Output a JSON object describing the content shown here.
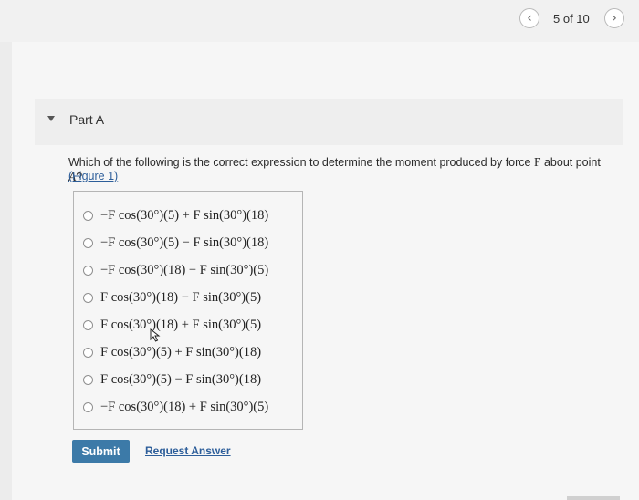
{
  "pagination": {
    "label": "5 of 10",
    "prev_icon": "‹",
    "next_icon": "›"
  },
  "part": {
    "title": "Part A"
  },
  "question": {
    "text_before_F": "Which of the following is the correct expression to determine the moment produced by force ",
    "force_symbol": "F",
    "text_between": " about point ",
    "point_symbol": "A",
    "text_after": "?",
    "figure_link": "(Figure 1)"
  },
  "options": [
    {
      "label": "−F cos(30°)(5) + F sin(30°)(18)"
    },
    {
      "label": "−F cos(30°)(5) − F sin(30°)(18)"
    },
    {
      "label": "−F cos(30°)(18) − F sin(30°)(5)"
    },
    {
      "label": "F cos(30°)(18) − F sin(30°)(5)"
    },
    {
      "label": "F cos(30°)(18) + F sin(30°)(5)"
    },
    {
      "label": "F cos(30°)(5) + F sin(30°)(18)"
    },
    {
      "label": "F cos(30°)(5) − F sin(30°)(18)"
    },
    {
      "label": "−F cos(30°)(18) + F sin(30°)(5)"
    }
  ],
  "actions": {
    "submit_label": "Submit",
    "request_answer_label": "Request Answer"
  }
}
